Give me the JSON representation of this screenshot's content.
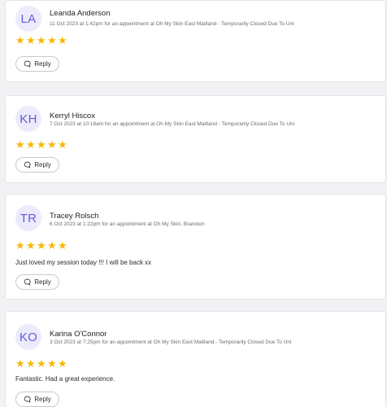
{
  "reviews": [
    {
      "initials": "LA",
      "name": "Leanda Anderson",
      "meta": "11 Oct 2023 at 1:42pm for an appointment at Oh My Skin East Maitland - Temporarily Closed Due To Uni",
      "rating": 5,
      "text": "",
      "reply_label": "Reply"
    },
    {
      "initials": "KH",
      "name": "Kerryl Hiscox",
      "meta": "7 Oct 2023 at 10:18am for an appointment at Oh My Skin East Maitland - Temporarily Closed Due To Uni",
      "rating": 5,
      "text": "",
      "reply_label": "Reply"
    },
    {
      "initials": "TR",
      "name": "Tracey Rolsch",
      "meta": "6 Oct 2023 at 1:22pm for an appointment at Oh My Skin, Branxton",
      "rating": 5,
      "text": "Just loved my session today !!! I will be back xx",
      "reply_label": "Reply"
    },
    {
      "initials": "KO",
      "name": "Karina O'Connor",
      "meta": "3 Oct 2023 at 7:25pm for an appointment at Oh My Skin East Maitland - Temporarily Closed Due To Uni",
      "rating": 5,
      "text": "Fantastic. Had a great experience.",
      "reply_label": "Reply"
    }
  ],
  "colors": {
    "avatar_bg": "#ecebfc",
    "avatar_text": "#6a5bd6",
    "star": "#f5b800"
  }
}
